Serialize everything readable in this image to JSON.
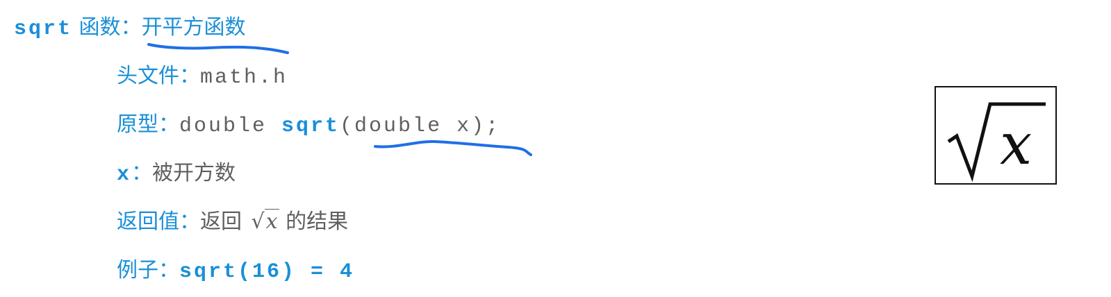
{
  "title": {
    "func": "sqrt",
    "suffix": " 函数：",
    "desc": "开平方函数"
  },
  "header_file": {
    "label": "头文件：",
    "value": "math.h"
  },
  "prototype": {
    "label": "原型：",
    "ret_type": "double ",
    "func_name": "sqrt",
    "args": "(double x);"
  },
  "param": {
    "name": "x",
    "sep": "：",
    "desc": "被开方数"
  },
  "return_value": {
    "label": "返回值：",
    "prefix": "返回 ",
    "math_radicand": "x",
    "suffix": " 的结果"
  },
  "example": {
    "label": "例子：",
    "code": "sqrt(16) = 4"
  },
  "formula_box": {
    "radicand": "x"
  },
  "colors": {
    "accent": "#1a8fd8",
    "text": "#5f5f5f",
    "annotation": "#1f6fe6"
  }
}
